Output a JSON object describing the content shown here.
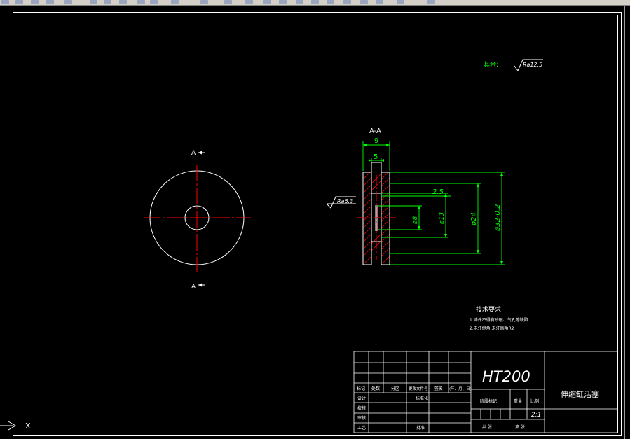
{
  "toolbar": {
    "icons": [
      "toolbar-icon",
      "toolbar-icon",
      "toolbar-icon",
      "toolbar-icon",
      "toolbar-icon",
      "toolbar-icon",
      "toolbar-icon",
      "toolbar-icon",
      "toolbar-icon",
      "toolbar-icon",
      "toolbar-icon",
      "toolbar-icon",
      "toolbar-icon",
      "toolbar-icon",
      "toolbar-icon",
      "toolbar-icon",
      "toolbar-icon",
      "toolbar-icon",
      "toolbar-icon",
      "toolbar-icon",
      "toolbar-icon",
      "toolbar-icon",
      "toolbar-icon",
      "toolbar-icon"
    ]
  },
  "colors": {
    "background": "#000000",
    "line": "#ffffff",
    "centerline": "#ff0000",
    "dimension": "#00ff00",
    "text": "#ffffff",
    "hatch": "#ff0000",
    "annotation_green": "#00ff00"
  },
  "drawing": {
    "roughness_other": {
      "prefix": "其余:",
      "value": "Ra12.5"
    },
    "section_label": "A-A",
    "cut_marker_top": "A",
    "cut_marker_bottom": "A",
    "roughness_face": "Ra6.3",
    "dimensions": {
      "width_total": "9",
      "width_inner": "5",
      "offset": "2.5",
      "dia_8": "ø8",
      "dia_13": "ø13",
      "dia_24": "ø24",
      "dia_32": "ø32-0.2"
    },
    "tech_req": {
      "title": "技术要求",
      "line1": "1.铸件不得有砂眼、气孔等缺陷",
      "line2": "2.未注倒角,未注圆角R2"
    }
  },
  "title_block": {
    "material": "HT200",
    "part_name": "伸缩缸活塞",
    "scale": "2:1",
    "headers": [
      "标记",
      "处数",
      "分区",
      "更改文件号",
      "签名",
      "(年、月、日)"
    ],
    "rows_left": [
      "设计",
      "校核",
      "审核",
      "工艺"
    ],
    "standardization": "标准化",
    "approve": "批准",
    "stage_mark": "阶段标记",
    "weight": "重量",
    "ratio": "比例",
    "sheets_total": "共   张",
    "sheet_no": "第   张"
  },
  "ucs": {
    "x_label": "X"
  }
}
